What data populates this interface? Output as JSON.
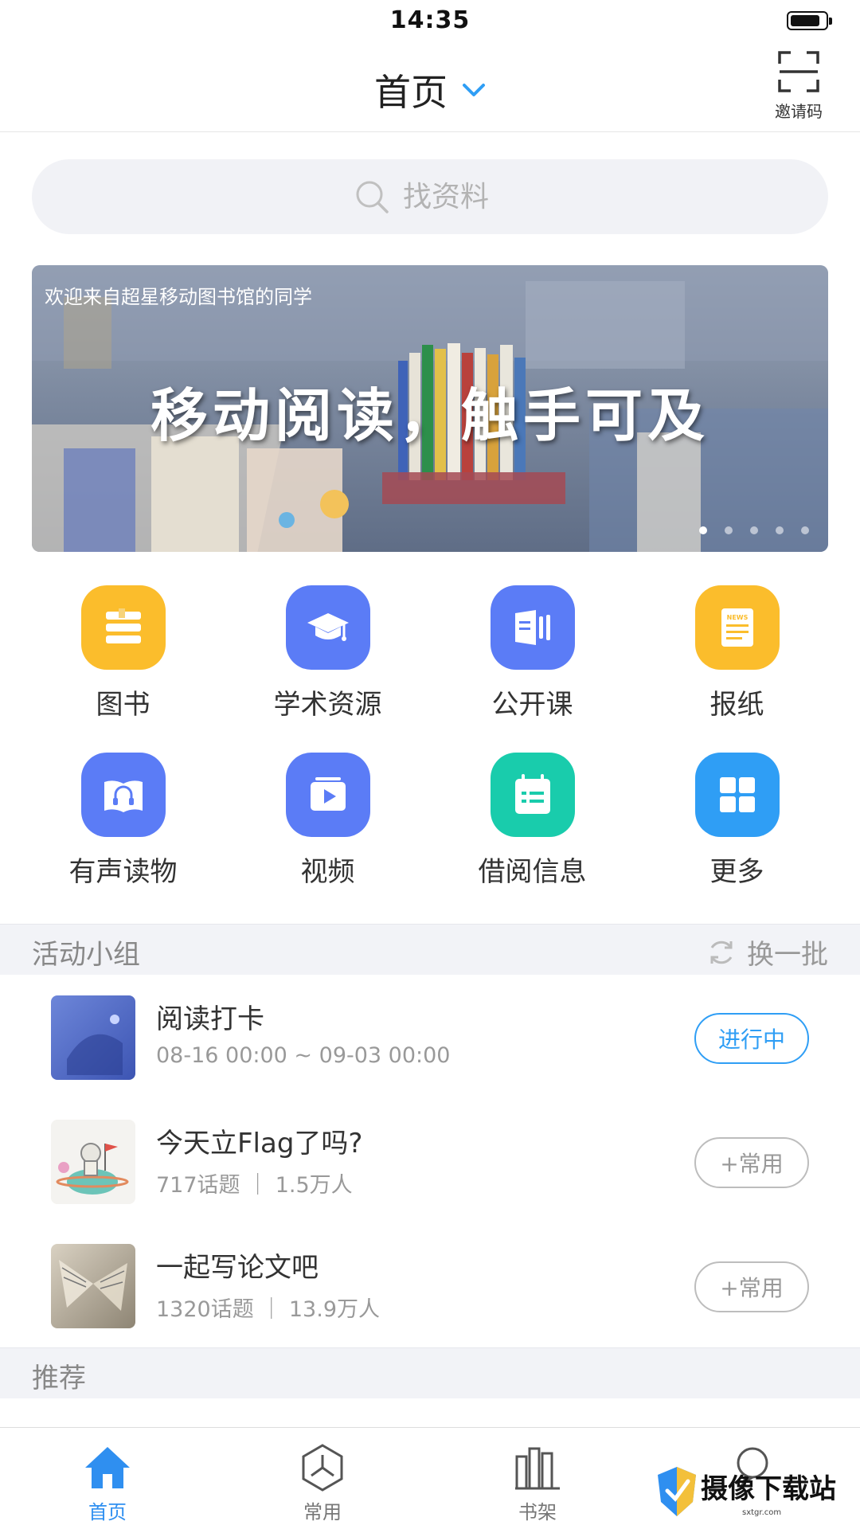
{
  "status_bar": {
    "time": "14:35",
    "battery_level": 0.85
  },
  "nav": {
    "title": "首页",
    "invite_label": "邀请码"
  },
  "search": {
    "placeholder": "找资料"
  },
  "banner": {
    "welcome": "欢迎来自超星移动图书馆的同学",
    "slogan": "移动阅读，触手可及",
    "page_count": 5,
    "active_page": 1
  },
  "features": [
    {
      "label": "图书",
      "icon": "books-icon",
      "color": "#fbbd2c"
    },
    {
      "label": "学术资源",
      "icon": "graduation-cap-icon",
      "color": "#5b7cf6"
    },
    {
      "label": "公开课",
      "icon": "open-course-icon",
      "color": "#5b7cf6"
    },
    {
      "label": "报纸",
      "icon": "newspaper-icon",
      "color": "#fbbd2c"
    },
    {
      "label": "有声读物",
      "icon": "audiobook-icon",
      "color": "#5b7cf6"
    },
    {
      "label": "视频",
      "icon": "video-icon",
      "color": "#5b7cf6"
    },
    {
      "label": "借阅信息",
      "icon": "calendar-icon",
      "color": "#19ccac"
    },
    {
      "label": "更多",
      "icon": "grid-more-icon",
      "color": "#2f9ef5"
    }
  ],
  "groups_section": {
    "title": "活动小组",
    "refresh_label": "换一批"
  },
  "groups": [
    {
      "name": "阅读打卡",
      "meta": "08-16 00:00 ~ 09-03 00:00",
      "button": "进行中"
    },
    {
      "name": "今天立Flag了吗?",
      "meta": "717话题 ｜ 1.5万人",
      "button": "+常用"
    },
    {
      "name": "一起写论文吧",
      "meta": "1320话题 ｜ 13.9万人",
      "button": "+常用"
    }
  ],
  "recommend_section": {
    "title": "推荐"
  },
  "tabs": [
    {
      "label": "首页",
      "icon": "home-icon"
    },
    {
      "label": "常用",
      "icon": "frequent-icon"
    },
    {
      "label": "书架",
      "icon": "bookshelf-icon"
    },
    {
      "label": "",
      "icon": "chat-icon"
    }
  ],
  "watermark": {
    "text": "摄像下载站",
    "sub": "sxtgr.com"
  },
  "colors": {
    "accent": "#2f9ef5",
    "tab_active": "#2f8ff0"
  }
}
